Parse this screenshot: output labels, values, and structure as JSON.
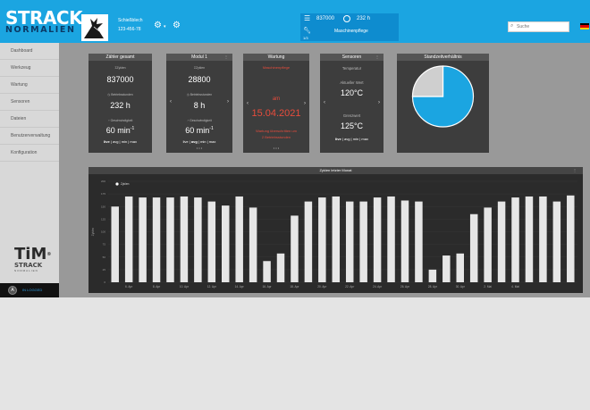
{
  "brand": {
    "logo_top": "STRACK",
    "logo_bottom": "NORMALIEN"
  },
  "header": {
    "part_name": "Schießblech",
    "part_number": "123-456-78",
    "cycles": "837000",
    "hours": "232 h",
    "maintenance_number": "1/3",
    "maintenance_label": "Maschinenpflege",
    "search_placeholder": "Suche",
    "flag_colors": [
      "#000000",
      "#dd0000",
      "#ffce00"
    ]
  },
  "sidebar": {
    "items": [
      {
        "label": "Dashboard",
        "active": true
      },
      {
        "label": "Werkzeug",
        "active": false
      },
      {
        "label": "Wartung",
        "active": false
      },
      {
        "label": "Sensoren",
        "active": false
      },
      {
        "label": "Dateien",
        "active": false
      },
      {
        "label": "Benutzerverwaltung",
        "active": false
      },
      {
        "label": "Konfiguration",
        "active": false
      }
    ],
    "tim_logo": "TiM",
    "tim_strack": "STRACK",
    "tim_normalien": "NORMALIEN",
    "user_initial": "A",
    "logged_in_label": "IN LOGGED"
  },
  "widgets": {
    "total": {
      "title": "Zähler gesamt",
      "cycles_label": "Zyklen",
      "cycles_value": "837000",
      "hours_label": "Betriebsstunden",
      "hours_value": "232 h",
      "speed_label": "Geschwindigkeit",
      "speed_value": "60 min",
      "speed_exp": "-1",
      "speed_modes": [
        "live",
        "avg",
        "min",
        "max"
      ],
      "speed_mode_active": "live"
    },
    "module1": {
      "title": "Modul 1",
      "cycles_label": "Zyklen",
      "cycles_value": "28800",
      "hours_label": "Betriebsstunden",
      "hours_value": "8 h",
      "speed_label": "Geschwindigkeit",
      "speed_value": "60 min",
      "speed_exp": "-1",
      "speed_modes": [
        "live",
        "avg",
        "min",
        "max"
      ],
      "speed_mode_active": "avg"
    },
    "maintenance": {
      "title": "Wartung",
      "subtitle": "Maschinenpflege",
      "prefix": "am",
      "date": "15.04.2021",
      "footer1": "Wartung überschritten um",
      "footer2": "2 Betriebsstunden"
    },
    "sensors": {
      "title": "Sensoren",
      "sensor_name": "Temperatur",
      "current_label": "Aktueller Wert",
      "current_value": "120°C",
      "limit_label": "Grenzwert",
      "limit_value": "125°C",
      "modes": [
        "live",
        "avg",
        "min",
        "max"
      ],
      "mode_active": "live"
    },
    "ratio": {
      "title": "Standzeitverhältnis",
      "slices": [
        {
          "fraction": 0.75,
          "color": "#1ba5e1"
        },
        {
          "fraction": 0.25,
          "color": "#cfcfcf"
        }
      ]
    }
  },
  "chart_data": {
    "type": "bar",
    "title": "Zyklen letzter Monat",
    "ylabel": "Zyklen",
    "series": [
      {
        "name": "Zyklen",
        "color": "#e6e6e6"
      }
    ],
    "ylim": [
      0,
      200
    ],
    "yticks": [
      "0",
      "25",
      "50",
      "75",
      "100",
      "125",
      "150",
      "175",
      "200"
    ],
    "xticks": [
      "6. Apr",
      "8. Apr",
      "10. Apr",
      "12. Apr",
      "14. Apr",
      "16. Apr",
      "18. Apr",
      "20. Apr",
      "22. Apr",
      "24. Apr",
      "26. Apr",
      "28. Apr",
      "30. Apr",
      "2. Mai",
      "4. Mai"
    ],
    "values": [
      150,
      170,
      168,
      168,
      168,
      170,
      168,
      160,
      152,
      170,
      148,
      42,
      57,
      132,
      160,
      168,
      170,
      160,
      160,
      168,
      170,
      162,
      160,
      25,
      53,
      57,
      135,
      148,
      160,
      168,
      170,
      170,
      160,
      172
    ]
  }
}
